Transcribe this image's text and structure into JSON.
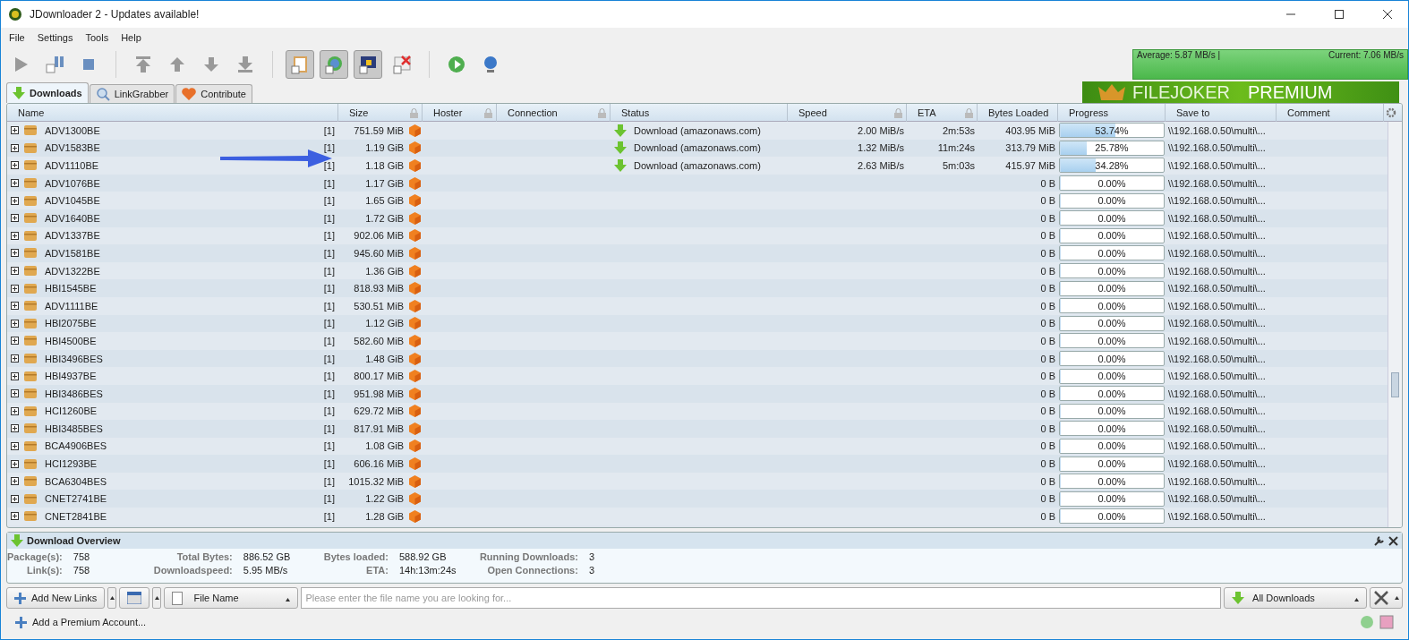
{
  "window": {
    "title": "JDownloader 2 - Updates available!"
  },
  "menu": [
    "File",
    "Settings",
    "Tools",
    "Help"
  ],
  "speed_meter": {
    "average": "Average: 5.87 MB/s |",
    "current": "Current: 7.06 MB/s"
  },
  "tabs": [
    {
      "label": "Downloads",
      "selected": true
    },
    {
      "label": "LinkGrabber",
      "selected": false
    },
    {
      "label": "Contribute",
      "selected": false
    }
  ],
  "banner": {
    "brand": "FILEJOKER",
    "tier": "PREMIUM"
  },
  "table": {
    "columns": [
      {
        "label": "Name",
        "locked": false
      },
      {
        "label": "Size",
        "locked": true
      },
      {
        "label": "Hoster",
        "locked": true
      },
      {
        "label": "Connection",
        "locked": true
      },
      {
        "label": "Status",
        "locked": false
      },
      {
        "label": "Speed",
        "locked": true
      },
      {
        "label": "ETA",
        "locked": true
      },
      {
        "label": "Bytes Loaded",
        "locked": false
      },
      {
        "label": "Progress",
        "locked": false
      },
      {
        "label": "Save to",
        "locked": false
      },
      {
        "label": "Comment",
        "locked": false
      }
    ],
    "rows": [
      {
        "name": "ADV1300BE",
        "count": "[1]",
        "size": "751.59 MiB",
        "status": "Download (amazonaws.com)",
        "speed": "2.00 MiB/s",
        "eta": "2m:53s",
        "loaded": "403.95 MiB",
        "progress": "53.74%",
        "level": 0.5374,
        "save_to": "\\\\192.168.0.50\\multi\\..."
      },
      {
        "name": "ADV1583BE",
        "count": "[1]",
        "size": "1.19 GiB",
        "status": "Download (amazonaws.com)",
        "speed": "1.32 MiB/s",
        "eta": "11m:24s",
        "loaded": "313.79 MiB",
        "progress": "25.78%",
        "level": 0.2578,
        "save_to": "\\\\192.168.0.50\\multi\\..."
      },
      {
        "name": "ADV1110BE",
        "count": "[1]",
        "size": "1.18 GiB",
        "status": "Download (amazonaws.com)",
        "speed": "2.63 MiB/s",
        "eta": "5m:03s",
        "loaded": "415.97 MiB",
        "progress": "34.28%",
        "level": 0.3428,
        "save_to": "\\\\192.168.0.50\\multi\\..."
      },
      {
        "name": "ADV1076BE",
        "count": "[1]",
        "size": "1.17 GiB",
        "loaded": "0 B",
        "progress": "0.00%",
        "level": 0,
        "save_to": "\\\\192.168.0.50\\multi\\..."
      },
      {
        "name": "ADV1045BE",
        "count": "[1]",
        "size": "1.65 GiB",
        "loaded": "0 B",
        "progress": "0.00%",
        "level": 0,
        "save_to": "\\\\192.168.0.50\\multi\\..."
      },
      {
        "name": "ADV1640BE",
        "count": "[1]",
        "size": "1.72 GiB",
        "loaded": "0 B",
        "progress": "0.00%",
        "level": 0,
        "save_to": "\\\\192.168.0.50\\multi\\..."
      },
      {
        "name": "ADV1337BE",
        "count": "[1]",
        "size": "902.06 MiB",
        "loaded": "0 B",
        "progress": "0.00%",
        "level": 0,
        "save_to": "\\\\192.168.0.50\\multi\\..."
      },
      {
        "name": "ADV1581BE",
        "count": "[1]",
        "size": "945.60 MiB",
        "loaded": "0 B",
        "progress": "0.00%",
        "level": 0,
        "save_to": "\\\\192.168.0.50\\multi\\..."
      },
      {
        "name": "ADV1322BE",
        "count": "[1]",
        "size": "1.36 GiB",
        "loaded": "0 B",
        "progress": "0.00%",
        "level": 0,
        "save_to": "\\\\192.168.0.50\\multi\\..."
      },
      {
        "name": "HBI1545BE",
        "count": "[1]",
        "size": "818.93 MiB",
        "loaded": "0 B",
        "progress": "0.00%",
        "level": 0,
        "save_to": "\\\\192.168.0.50\\multi\\..."
      },
      {
        "name": "ADV1111BE",
        "count": "[1]",
        "size": "530.51 MiB",
        "loaded": "0 B",
        "progress": "0.00%",
        "level": 0,
        "save_to": "\\\\192.168.0.50\\multi\\..."
      },
      {
        "name": "HBI2075BE",
        "count": "[1]",
        "size": "1.12 GiB",
        "loaded": "0 B",
        "progress": "0.00%",
        "level": 0,
        "save_to": "\\\\192.168.0.50\\multi\\..."
      },
      {
        "name": "HBI4500BE",
        "count": "[1]",
        "size": "582.60 MiB",
        "loaded": "0 B",
        "progress": "0.00%",
        "level": 0,
        "save_to": "\\\\192.168.0.50\\multi\\..."
      },
      {
        "name": "HBI3496BES",
        "count": "[1]",
        "size": "1.48 GiB",
        "loaded": "0 B",
        "progress": "0.00%",
        "level": 0,
        "save_to": "\\\\192.168.0.50\\multi\\..."
      },
      {
        "name": "HBI4937BE",
        "count": "[1]",
        "size": "800.17 MiB",
        "loaded": "0 B",
        "progress": "0.00%",
        "level": 0,
        "save_to": "\\\\192.168.0.50\\multi\\..."
      },
      {
        "name": "HBI3486BES",
        "count": "[1]",
        "size": "951.98 MiB",
        "loaded": "0 B",
        "progress": "0.00%",
        "level": 0,
        "save_to": "\\\\192.168.0.50\\multi\\..."
      },
      {
        "name": "HCI1260BE",
        "count": "[1]",
        "size": "629.72 MiB",
        "loaded": "0 B",
        "progress": "0.00%",
        "level": 0,
        "save_to": "\\\\192.168.0.50\\multi\\..."
      },
      {
        "name": "HBI3485BES",
        "count": "[1]",
        "size": "817.91 MiB",
        "loaded": "0 B",
        "progress": "0.00%",
        "level": 0,
        "save_to": "\\\\192.168.0.50\\multi\\..."
      },
      {
        "name": "BCA4906BES",
        "count": "[1]",
        "size": "1.08 GiB",
        "loaded": "0 B",
        "progress": "0.00%",
        "level": 0,
        "save_to": "\\\\192.168.0.50\\multi\\..."
      },
      {
        "name": "HCI1293BE",
        "count": "[1]",
        "size": "606.16 MiB",
        "loaded": "0 B",
        "progress": "0.00%",
        "level": 0,
        "save_to": "\\\\192.168.0.50\\multi\\..."
      },
      {
        "name": "BCA6304BES",
        "count": "[1]",
        "size": "1015.32 MiB",
        "loaded": "0 B",
        "progress": "0.00%",
        "level": 0,
        "save_to": "\\\\192.168.0.50\\multi\\..."
      },
      {
        "name": "CNET2741BE",
        "count": "[1]",
        "size": "1.22 GiB",
        "loaded": "0 B",
        "progress": "0.00%",
        "level": 0,
        "save_to": "\\\\192.168.0.50\\multi\\..."
      },
      {
        "name": "CNET2841BE",
        "count": "[1]",
        "size": "1.28 GiB",
        "loaded": "0 B",
        "progress": "0.00%",
        "level": 0,
        "save_to": "\\\\192.168.0.50\\multi\\..."
      }
    ]
  },
  "overview": {
    "title": "Download Overview",
    "stats": [
      {
        "label": "Package(s):",
        "value": "758"
      },
      {
        "label": "Total Bytes:",
        "value": "886.52 GB"
      },
      {
        "label": "Bytes loaded:",
        "value": "588.92 GB"
      },
      {
        "label": "Running Downloads:",
        "value": "3"
      },
      {
        "label": "Link(s):",
        "value": "758"
      },
      {
        "label": "Downloadspeed:",
        "value": "5.95 MB/s"
      },
      {
        "label": "ETA:",
        "value": "14h:13m:24s"
      },
      {
        "label": "Open Connections:",
        "value": "3"
      }
    ]
  },
  "bottom_bar": {
    "add_links": "Add New Links",
    "search_by": "File Name",
    "search": {
      "placeholder": "Please enter the file name you are looking for..."
    },
    "view": "All Downloads"
  },
  "status_bar": {
    "premium": "Add a Premium Account..."
  }
}
